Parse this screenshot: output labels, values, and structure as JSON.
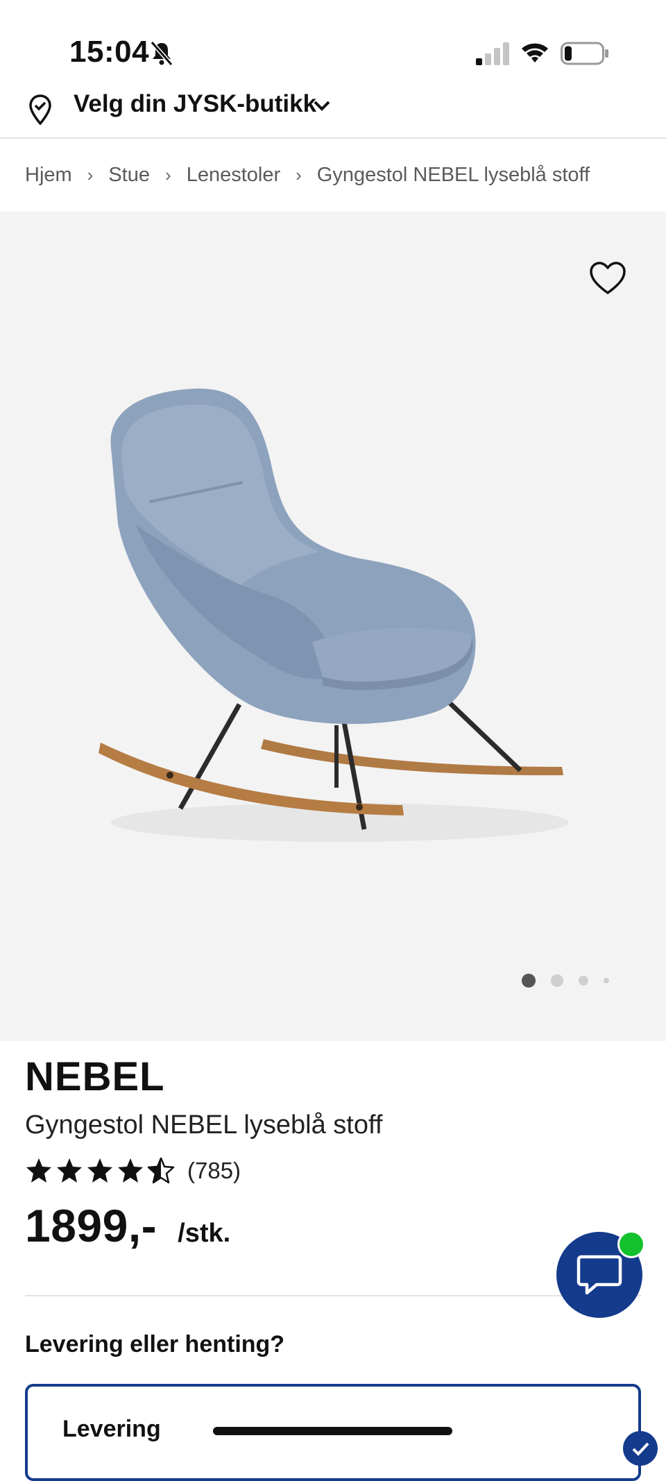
{
  "status_bar": {
    "time": "15:04",
    "battery_level": 0.2
  },
  "store_selector": {
    "label": "Velg din JYSK-butikk"
  },
  "breadcrumb": [
    "Hjem",
    "Stue",
    "Lenestoler",
    "Gyngestol NEBEL lyseblå stoff"
  ],
  "gallery": {
    "image_count": 4,
    "active_index": 0,
    "favorite_icon": "heart-outline-icon"
  },
  "product": {
    "title": "NEBEL",
    "subtitle": "Gyngestol NEBEL lyseblå stoff",
    "rating": 4.5,
    "rating_max": 5,
    "review_count": "(785)",
    "price": "1899,-",
    "unit": "/stk."
  },
  "delivery": {
    "heading": "Levering eller henting?",
    "option_label": "Levering"
  },
  "colors": {
    "brand_blue": "#143b8c",
    "online_green": "#12c12c",
    "gallery_background": "#f3f3f3"
  }
}
